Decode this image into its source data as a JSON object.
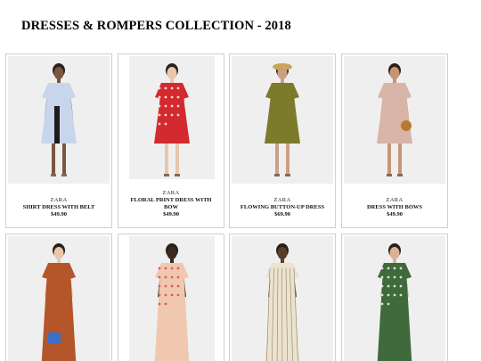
{
  "page": {
    "title": "DRESSES & ROMPERS COLLECTION - 2018"
  },
  "products": [
    {
      "brand": "ZARA",
      "name": "SHIRT DRESS WITH BELT",
      "price": "$49.90",
      "dress_color": "#c8d6ec",
      "accent": "#1c1c1c",
      "skin": "#7a5740",
      "bg": "#efefef"
    },
    {
      "brand": "ZARA",
      "name": "FLORAL PRINT DRESS WITH BOW",
      "price": "$49.90",
      "dress_color": "#d22a2e",
      "accent": "#ffffff",
      "skin": "#e8c7ad",
      "bg": "#efefef"
    },
    {
      "brand": "ZARA",
      "name": "FLOWING BUTTON-UP DRESS",
      "price": "$69.90",
      "dress_color": "#7c7b2c",
      "accent": "#c9a45c",
      "skin": "#caa085",
      "bg": "#efefef"
    },
    {
      "brand": "ZARA",
      "name": "DRESS WITH BOWS",
      "price": "$49.90",
      "dress_color": "#d9b4a8",
      "accent": "#b87a2f",
      "skin": "#c69577",
      "bg": "#efefef"
    },
    {
      "brand": "",
      "name": "",
      "price": "",
      "dress_color": "#b4562a",
      "accent": "#3c6fc8",
      "skin": "#e9c8ad",
      "bg": "#efefef"
    },
    {
      "brand": "",
      "name": "",
      "price": "",
      "dress_color": "#f0c8b0",
      "accent": "#d8453b",
      "skin": "#3a2a22",
      "bg": "#efefef"
    },
    {
      "brand": "",
      "name": "",
      "price": "",
      "dress_color": "#ece3cf",
      "accent": "#8d7f6a",
      "skin": "#5b3d2c",
      "bg": "#efefef"
    },
    {
      "brand": "",
      "name": "",
      "price": "",
      "dress_color": "#3f6a3b",
      "accent": "#ffffff",
      "skin": "#d9b295",
      "bg": "#efefef"
    }
  ]
}
